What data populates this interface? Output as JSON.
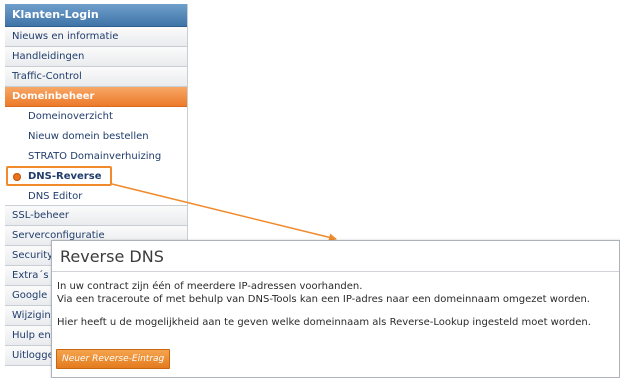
{
  "sidebar": {
    "header": "Klanten-Login",
    "items_top": [
      "Nieuws en informatie",
      "Handleidingen",
      "Traffic-Control"
    ],
    "section": "Domeinbeheer",
    "sub_items": [
      "Domeinoverzicht",
      "Nieuw domein bestellen",
      "STRATO Domainverhuizing"
    ],
    "active_item": "DNS-Reverse",
    "sub_after": "DNS Editor",
    "items_bottom": [
      "SSL-beheer",
      "Serverconfiguratie",
      "Security",
      "Extra´s",
      "Google",
      "Wijziging",
      "Hulp en",
      "Uitloggen"
    ]
  },
  "popup": {
    "title": "Reverse DNS",
    "line1": "In uw contract zijn één of meerdere IP-adressen voorhanden.",
    "line2": "Via een traceroute of met behulp van DNS-Tools kan een IP-adres naar een domeinnaam omgezet worden.",
    "line3": "Hier heeft u de mogelijkheid aan te geven welke domeinnaam als Reverse-Lookup ingesteld moet worden.",
    "button": "Neuer Reverse-Eintrag"
  },
  "colors": {
    "accent_orange": "#ec7a2a",
    "header_blue": "#3f74a8",
    "link_blue": "#1f3c6b"
  }
}
